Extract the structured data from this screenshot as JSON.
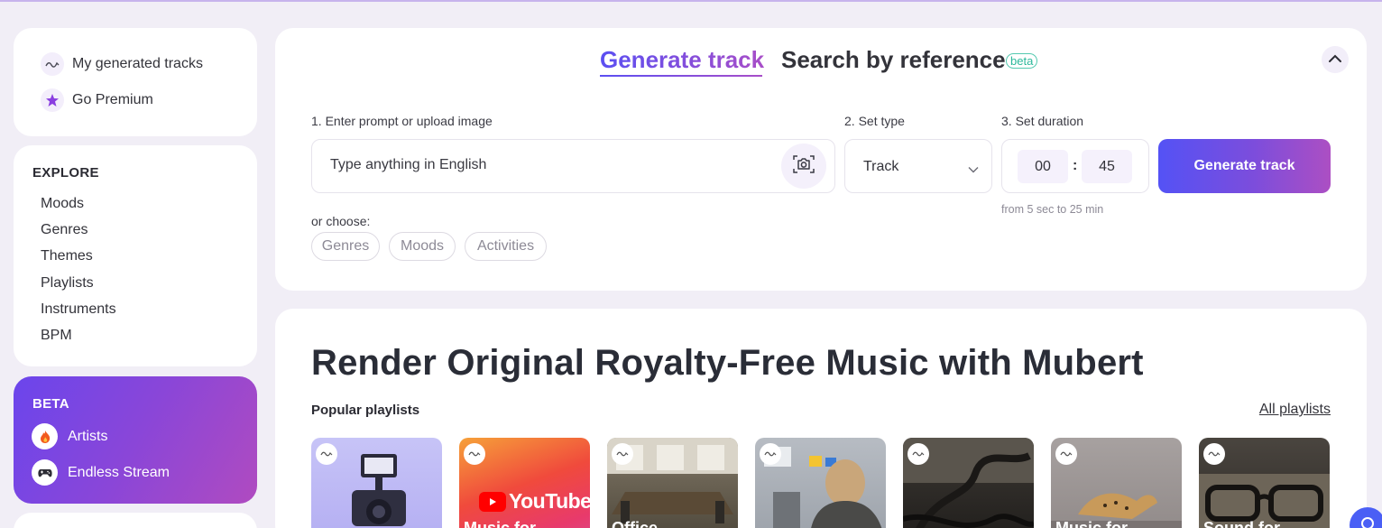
{
  "sidebar": {
    "my_tracks_label": "My generated tracks",
    "go_premium_label": "Go Premium",
    "explore_title": "EXPLORE",
    "explore_items": [
      "Moods",
      "Genres",
      "Themes",
      "Playlists",
      "Instruments",
      "BPM"
    ],
    "beta_title": "BETA",
    "beta_items": [
      "Artists",
      "Endless Stream"
    ]
  },
  "generator": {
    "tab_generate": "Generate track",
    "tab_search": "Search by reference",
    "beta_badge": "beta",
    "step1_label": "1. Enter prompt or upload image",
    "prompt_placeholder": "Type anything in English",
    "step2_label": "2. Set type",
    "type_value": "Track",
    "step3_label": "3. Set duration",
    "duration_minutes": "00",
    "duration_separator": ":",
    "duration_seconds": "45",
    "duration_hint": "from 5 sec to 25 min",
    "generate_button": "Generate track",
    "or_choose_label": "or choose:",
    "chips": [
      "Genres",
      "Moods",
      "Activities"
    ]
  },
  "content": {
    "hero_title": "Render Original Royalty-Free Music with Mubert",
    "popular_label": "Popular playlists",
    "all_playlists_link": "All playlists",
    "youtube_logo_text": "YouTube",
    "playlists": [
      {
        "title": ""
      },
      {
        "title": "Music for"
      },
      {
        "title": "Office"
      },
      {
        "title": ""
      },
      {
        "title": ""
      },
      {
        "title": "Music for"
      },
      {
        "title": "Sound for"
      }
    ]
  },
  "colors": {
    "accent_start": "#5452f5",
    "accent_end": "#ac4fc3",
    "page_bg": "#f1eef6",
    "beta_teal": "#2bb89a"
  },
  "icons": {
    "my_tracks": "wave-icon",
    "premium": "star-icon",
    "artists": "fire-icon",
    "endless_stream": "gamepad-icon",
    "camera": "camera-scan-icon",
    "collapse": "chevron-up-icon",
    "type_select": "chevron-down-icon",
    "tile_badge": "wave-icon"
  }
}
